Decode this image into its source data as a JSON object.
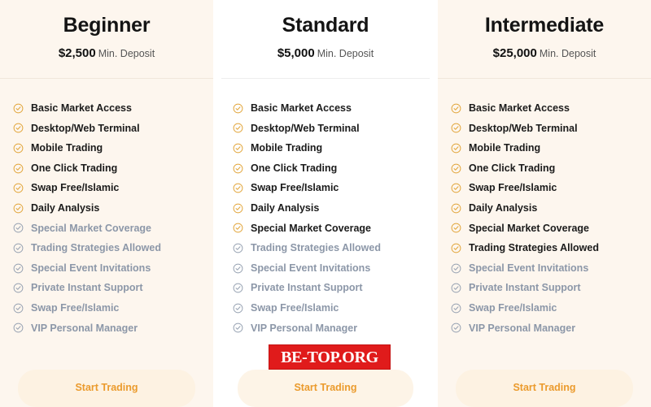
{
  "plans": [
    {
      "name": "Beginner",
      "price": "$2,500",
      "price_note": "Min. Deposit",
      "cta_label": "Start Trading",
      "features": [
        {
          "label": "Basic Market Access",
          "active": true
        },
        {
          "label": "Desktop/Web Terminal",
          "active": true
        },
        {
          "label": "Mobile Trading",
          "active": true
        },
        {
          "label": "One Click Trading",
          "active": true
        },
        {
          "label": "Swap Free/Islamic",
          "active": true
        },
        {
          "label": "Daily Analysis",
          "active": true
        },
        {
          "label": "Special Market Coverage",
          "active": false
        },
        {
          "label": "Trading Strategies Allowed",
          "active": false
        },
        {
          "label": "Special Event Invitations",
          "active": false
        },
        {
          "label": "Private Instant Support",
          "active": false
        },
        {
          "label": "Swap Free/Islamic",
          "active": false
        },
        {
          "label": "VIP Personal Manager",
          "active": false
        }
      ]
    },
    {
      "name": "Standard",
      "price": "$5,000",
      "price_note": "Min. Deposit",
      "cta_label": "Start Trading",
      "features": [
        {
          "label": "Basic Market Access",
          "active": true
        },
        {
          "label": "Desktop/Web Terminal",
          "active": true
        },
        {
          "label": "Mobile Trading",
          "active": true
        },
        {
          "label": "One Click Trading",
          "active": true
        },
        {
          "label": "Swap Free/Islamic",
          "active": true
        },
        {
          "label": "Daily Analysis",
          "active": true
        },
        {
          "label": "Special Market Coverage",
          "active": true
        },
        {
          "label": "Trading Strategies Allowed",
          "active": false
        },
        {
          "label": "Special Event Invitations",
          "active": false
        },
        {
          "label": "Private Instant Support",
          "active": false
        },
        {
          "label": "Swap Free/Islamic",
          "active": false
        },
        {
          "label": "VIP Personal Manager",
          "active": false
        }
      ]
    },
    {
      "name": "Intermediate",
      "price": "$25,000",
      "price_note": "Min. Deposit",
      "cta_label": "Start Trading",
      "features": [
        {
          "label": "Basic Market Access",
          "active": true
        },
        {
          "label": "Desktop/Web Terminal",
          "active": true
        },
        {
          "label": "Mobile Trading",
          "active": true
        },
        {
          "label": "One Click Trading",
          "active": true
        },
        {
          "label": "Swap Free/Islamic",
          "active": true
        },
        {
          "label": "Daily Analysis",
          "active": true
        },
        {
          "label": "Special Market Coverage",
          "active": true
        },
        {
          "label": "Trading Strategies Allowed",
          "active": true
        },
        {
          "label": "Special Event Invitations",
          "active": false
        },
        {
          "label": "Private Instant Support",
          "active": false
        },
        {
          "label": "Swap Free/Islamic",
          "active": false
        },
        {
          "label": "VIP Personal Manager",
          "active": false
        }
      ]
    }
  ],
  "watermark": {
    "text": "BE-TOP.ORG"
  },
  "colors": {
    "check_active": "#e2a63c",
    "check_inactive": "#98a3b3",
    "label_active": "#1b1b1b",
    "label_inactive": "#8c97a8",
    "cta_text": "#eb9b2d",
    "cta_bg": "#fdf2e2",
    "card_side_bg": "#fdf6ee",
    "card_mid_bg": "#ffffff",
    "watermark_bg": "#e01b1b"
  }
}
